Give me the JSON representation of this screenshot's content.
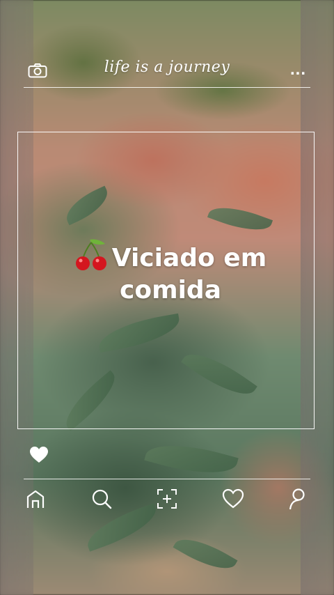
{
  "header": {
    "title": "life is a journey",
    "camera_icon": "camera-icon",
    "more_icon": "more-icon",
    "more_glyph": "..."
  },
  "post": {
    "caption_line1": "Viciado em",
    "caption_line2": "comida",
    "emoji_icon": "cherries-icon"
  },
  "actions": {
    "like_icon": "heart-filled-icon"
  },
  "nav": {
    "items": [
      {
        "icon": "home-icon"
      },
      {
        "icon": "search-icon"
      },
      {
        "icon": "add-post-icon"
      },
      {
        "icon": "heart-outline-icon"
      },
      {
        "icon": "profile-icon"
      }
    ]
  },
  "colors": {
    "overlay_text": "#ffffff",
    "cherry_red": "#d4161f",
    "leaf_green": "#6fb33a"
  }
}
